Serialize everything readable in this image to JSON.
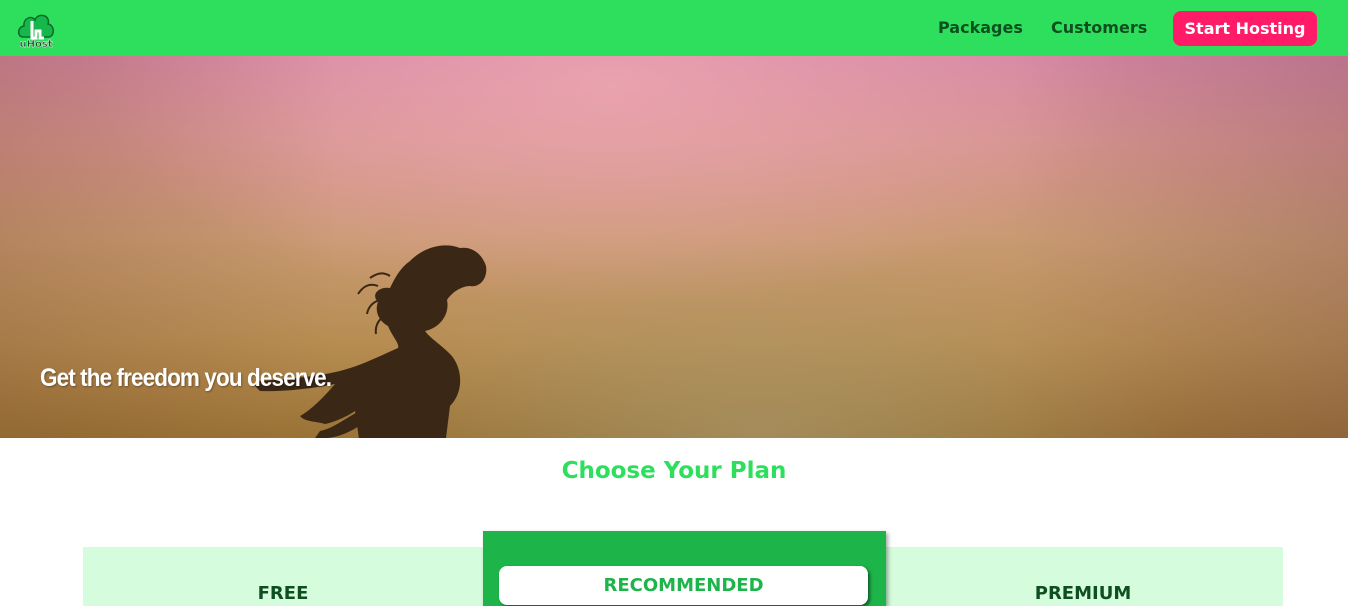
{
  "header": {
    "logo_text": "uHost",
    "nav": {
      "packages_label": "Packages",
      "customers_label": "Customers",
      "cta_label": "Start Hosting"
    }
  },
  "hero": {
    "tagline": "Get the freedom you deserve."
  },
  "plans": {
    "section_title": "Choose Your Plan",
    "free_title": "FREE",
    "recommended_badge": "RECOMMENDED",
    "premium_title": "PREMIUM"
  },
  "colors": {
    "header_bg": "#2ddf5c",
    "cta_bg": "#ff1b68",
    "plan_bg": "#d5fcdc",
    "recommended_bg": "#1db54a",
    "nav_text": "#0e4f1f"
  }
}
